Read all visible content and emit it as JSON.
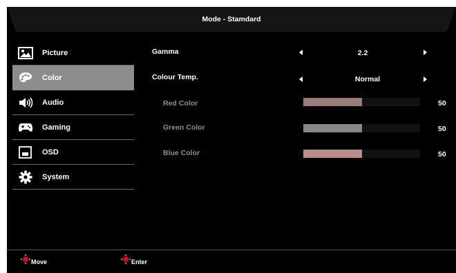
{
  "header": {
    "title": "Mode - Stamdard"
  },
  "sidebar": {
    "items": [
      {
        "label": "Picture",
        "icon": "picture-icon"
      },
      {
        "label": "Color",
        "icon": "palette-icon",
        "active": true
      },
      {
        "label": "Audio",
        "icon": "speaker-icon"
      },
      {
        "label": "Gaming",
        "icon": "gamepad-icon"
      },
      {
        "label": "OSD",
        "icon": "osd-window-icon"
      },
      {
        "label": "System",
        "icon": "gear-icon"
      }
    ]
  },
  "main": {
    "gamma": {
      "label": "Gamma",
      "value": "2.2"
    },
    "colour_temp": {
      "label": "Colour Temp.",
      "value": "Normal"
    },
    "sliders": [
      {
        "label": "Red Color",
        "value": "50",
        "level": 0.5,
        "color": "#9b7b7b"
      },
      {
        "label": "Green Color",
        "value": "50",
        "level": 0.5,
        "color": "#8a8686"
      },
      {
        "label": "Blue Color",
        "value": "50",
        "level": 0.5,
        "color": "#b88d8d"
      }
    ]
  },
  "footer": {
    "move_label": "Move",
    "enter_label": "Enter",
    "accent_color": "#e0002a"
  }
}
